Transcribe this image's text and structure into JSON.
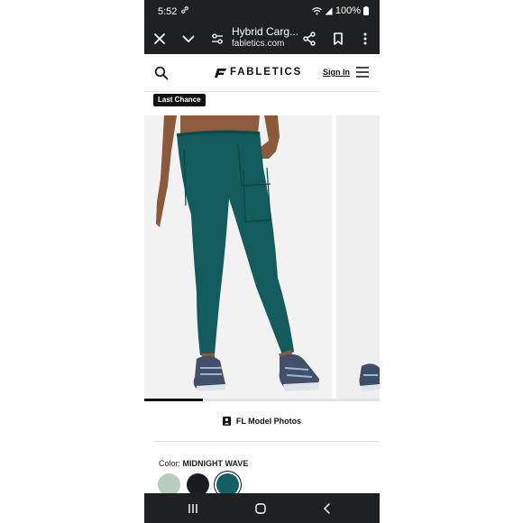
{
  "status_bar": {
    "time": "5:52",
    "battery": "100%"
  },
  "browser": {
    "page_title": "Hybrid Carg...",
    "domain": "fabletics.com"
  },
  "header": {
    "brand": "FABLETICS",
    "sign_in": "Sign In"
  },
  "product": {
    "badge": "Last Chance",
    "image_progress": 0.25,
    "model_photos_label": "FL Model Photos"
  },
  "color": {
    "label": "Color:",
    "selected_name": "MIDNIGHT WAVE",
    "swatches": [
      {
        "name": "sage",
        "hex": "#b9cdbf"
      },
      {
        "name": "black",
        "hex": "#1b1c20"
      },
      {
        "name": "midnight-wave",
        "hex": "#145f63"
      }
    ]
  },
  "colors": {
    "bar_bg": "#1f2021",
    "pant_teal": "#135b5d"
  }
}
